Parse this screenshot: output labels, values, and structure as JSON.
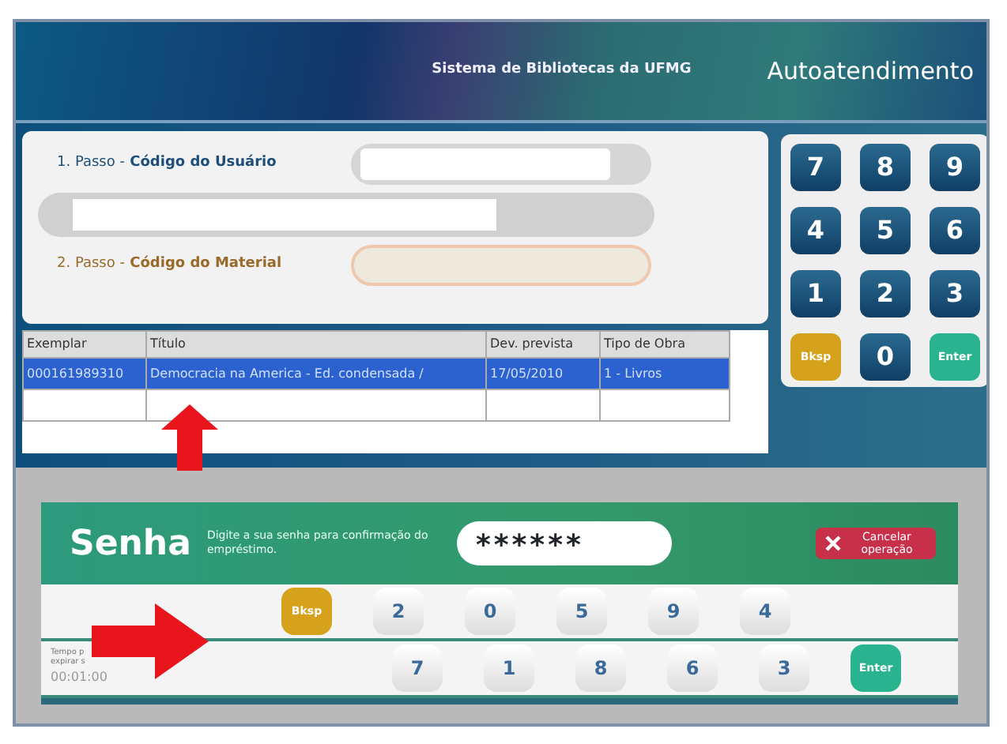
{
  "header": {
    "system_name": "Sistema de Bibliotecas da UFMG",
    "title": "Autoatendimento"
  },
  "steps": [
    {
      "number": "1. Passo -",
      "label": "Código do Usuário",
      "kind": "user"
    },
    {
      "number": "2. Passo -",
      "label": "Código do Material",
      "kind": "material"
    }
  ],
  "keypad": [
    {
      "label": "7",
      "kind": "digit"
    },
    {
      "label": "8",
      "kind": "digit"
    },
    {
      "label": "9",
      "kind": "digit"
    },
    {
      "label": "4",
      "kind": "digit"
    },
    {
      "label": "5",
      "kind": "digit"
    },
    {
      "label": "6",
      "kind": "digit"
    },
    {
      "label": "1",
      "kind": "digit"
    },
    {
      "label": "2",
      "kind": "digit"
    },
    {
      "label": "3",
      "kind": "digit"
    },
    {
      "label": "Bksp",
      "kind": "back"
    },
    {
      "label": "0",
      "kind": "digit"
    },
    {
      "label": "Enter",
      "kind": "enter"
    }
  ],
  "table": {
    "columns": [
      "Exemplar",
      "Título",
      "Dev. prevista",
      "Tipo de Obra"
    ],
    "rows": [
      {
        "cells": [
          "000161989310",
          "Democracia na America - Ed. condensada /",
          "17/05/2010",
          "1 - Livros"
        ],
        "selected": true
      }
    ]
  },
  "password": {
    "title": "Senha",
    "hint": "Digite a sua senha para confirmação do empréstimo.",
    "value": "******",
    "cancel": "Cancelar operação"
  },
  "password_keys": [
    [
      {
        "label": "Bksp",
        "kind": "back"
      },
      {
        "label": "2",
        "kind": "digit"
      },
      {
        "label": "0",
        "kind": "digit"
      },
      {
        "label": "5",
        "kind": "digit"
      },
      {
        "label": "9",
        "kind": "digit"
      },
      {
        "label": "4",
        "kind": "digit"
      }
    ],
    [
      {
        "label": "7",
        "kind": "digit"
      },
      {
        "label": "1",
        "kind": "digit"
      },
      {
        "label": "8",
        "kind": "digit"
      },
      {
        "label": "6",
        "kind": "digit"
      },
      {
        "label": "3",
        "kind": "digit"
      },
      {
        "label": "Enter",
        "kind": "enter"
      }
    ]
  ],
  "timer": {
    "caption": "Tempo p expirar s",
    "value": "00:01:00"
  },
  "annotations": [
    {
      "kind": "arrow-up"
    },
    {
      "kind": "arrow-right"
    }
  ]
}
